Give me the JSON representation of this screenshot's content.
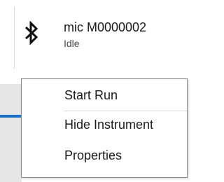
{
  "instrument": {
    "name": "mic M0000002",
    "status": "Idle",
    "icon": "bluetooth-icon"
  },
  "context_menu": {
    "items": [
      {
        "label": "Start Run"
      },
      {
        "label": "Hide Instrument"
      },
      {
        "label": "Properties"
      }
    ]
  },
  "colors": {
    "accent": "#1a6fc1",
    "menu_border": "#8a8a8a"
  }
}
